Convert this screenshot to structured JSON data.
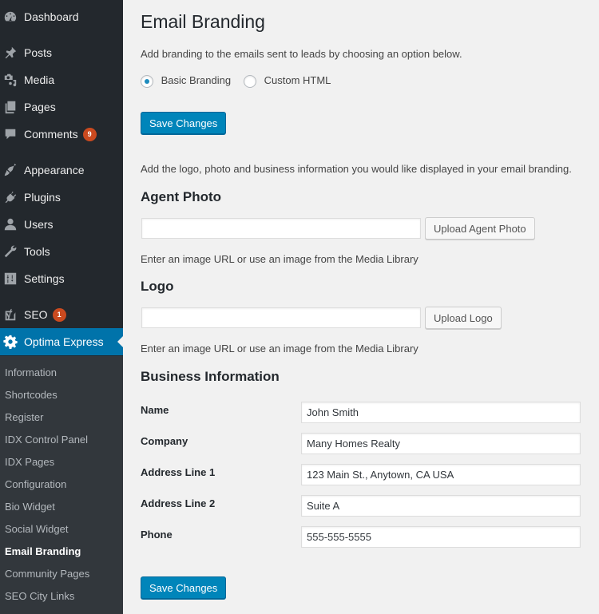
{
  "sidebar": {
    "items": [
      {
        "label": "Dashboard",
        "icon": "dashboard-icon"
      },
      {
        "label": "Posts",
        "icon": "pin-icon"
      },
      {
        "label": "Media",
        "icon": "media-icon"
      },
      {
        "label": "Pages",
        "icon": "pages-icon"
      },
      {
        "label": "Comments",
        "icon": "comment-icon",
        "badge": "9"
      },
      {
        "label": "Appearance",
        "icon": "paintbrush-icon"
      },
      {
        "label": "Plugins",
        "icon": "plug-icon"
      },
      {
        "label": "Users",
        "icon": "user-icon"
      },
      {
        "label": "Tools",
        "icon": "wrench-icon"
      },
      {
        "label": "Settings",
        "icon": "sliders-icon"
      },
      {
        "label": "SEO",
        "icon": "yoast-icon",
        "badge": "1"
      },
      {
        "label": "Optima Express",
        "icon": "gear-icon",
        "active": true
      }
    ],
    "submenu": [
      "Information",
      "Shortcodes",
      "Register",
      "IDX Control Panel",
      "IDX Pages",
      "Configuration",
      "Bio Widget",
      "Social Widget",
      "Email Branding",
      "Community Pages",
      "SEO City Links"
    ],
    "current_submenu": "Email Branding",
    "colors": {
      "background": "#23282d",
      "submenu_background": "#32373c",
      "active": "#0073aa",
      "badge": "#ca4a1f"
    }
  },
  "main": {
    "title": "Email Branding",
    "intro": "Add branding to the emails sent to leads by choosing an option below.",
    "branding_options": [
      {
        "label": "Basic Branding",
        "checked": true
      },
      {
        "label": "Custom HTML",
        "checked": false
      }
    ],
    "save_label": "Save Changes",
    "details_intro": "Add the logo, photo and business information you would like displayed in your email branding.",
    "agent_photo": {
      "heading": "Agent Photo",
      "value": "",
      "button": "Upload Agent Photo",
      "help": "Enter an image URL or use an image from the Media Library"
    },
    "logo": {
      "heading": "Logo",
      "value": "",
      "button": "Upload Logo",
      "help": "Enter an image URL or use an image from the Media Library"
    },
    "business": {
      "heading": "Business Information",
      "fields": [
        {
          "label": "Name",
          "value": "John Smith"
        },
        {
          "label": "Company",
          "value": "Many Homes Realty"
        },
        {
          "label": "Address Line 1",
          "value": "123 Main St., Anytown, CA USA"
        },
        {
          "label": "Address Line 2",
          "value": "Suite A"
        },
        {
          "label": "Phone",
          "value": "555-555-5555"
        }
      ]
    },
    "colors": {
      "primary_button": "#0085ba",
      "background": "#f1f1f1"
    }
  }
}
